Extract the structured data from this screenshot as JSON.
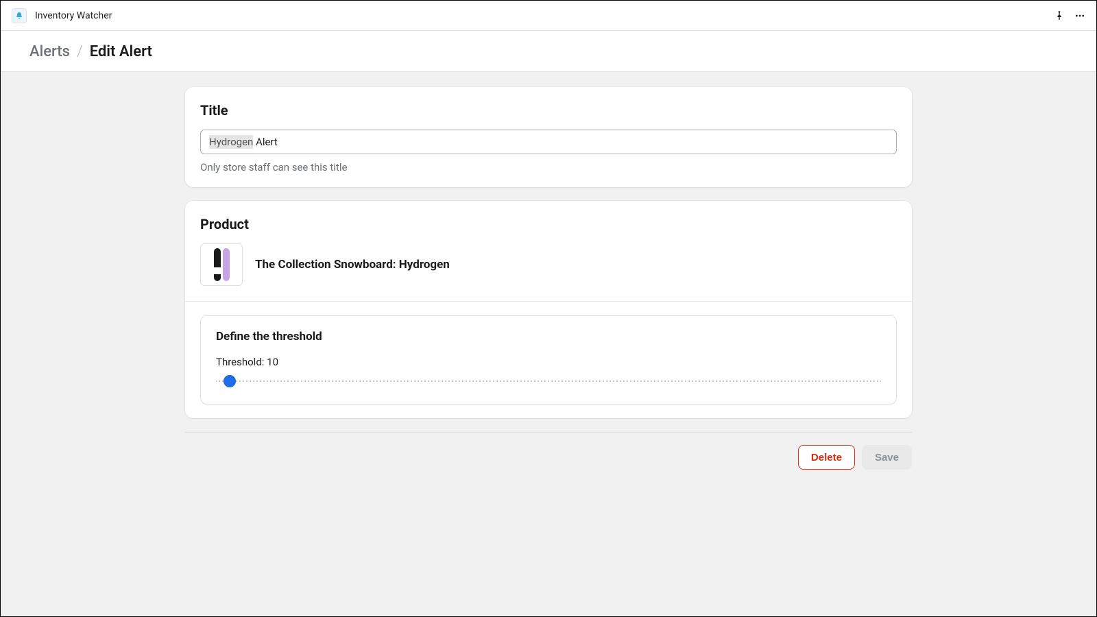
{
  "topbar": {
    "app_name": "Inventory Watcher"
  },
  "breadcrumb": {
    "parent": "Alerts",
    "separator": "/",
    "current": "Edit Alert"
  },
  "title_section": {
    "heading": "Title",
    "input_value": "Hydrogen Alert",
    "spellcheck_word": "Hydrogen",
    "help_text": "Only store staff can see this title"
  },
  "product_section": {
    "heading": "Product",
    "product_name": "The Collection Snowboard: Hydrogen"
  },
  "threshold_section": {
    "heading": "Define the threshold",
    "label_prefix": "Threshold: ",
    "value": 10,
    "min": 0,
    "max": 1000
  },
  "actions": {
    "delete_label": "Delete",
    "save_label": "Save"
  }
}
